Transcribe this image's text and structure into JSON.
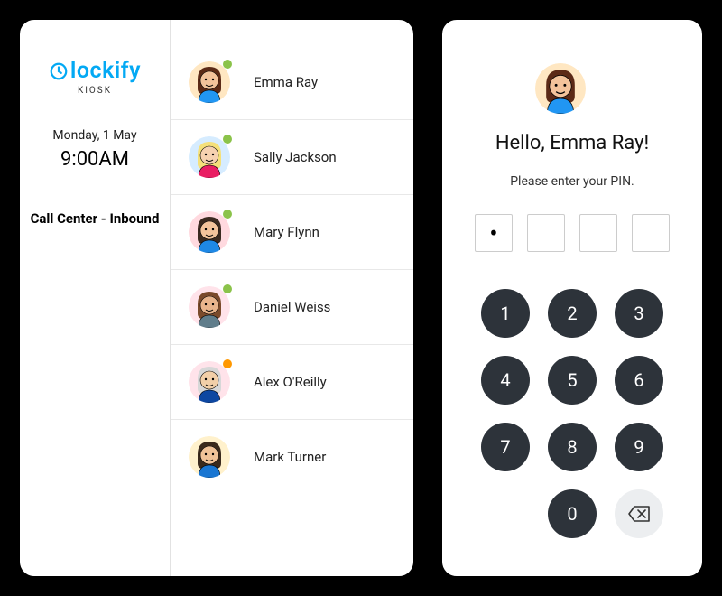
{
  "brand": {
    "name": "lockify",
    "sub": "KIOSK",
    "color": "#03a9f4"
  },
  "sidebar": {
    "date": "Monday, 1 May",
    "time": "9:00AM",
    "department": "Call Center - Inbound"
  },
  "status_colors": {
    "green": "#8bc34a",
    "orange": "#ff9800"
  },
  "members": [
    {
      "name": "Emma Ray",
      "status": "green",
      "bg": "#ffe7c2",
      "hair": "#5c2a16",
      "skin": "#f3c39b",
      "shirt": "#2196f3"
    },
    {
      "name": "Sally Jackson",
      "status": "green",
      "bg": "#d6ecff",
      "hair": "#f5e07a",
      "skin": "#f6d1b0",
      "shirt": "#e91e63"
    },
    {
      "name": "Mary Flynn",
      "status": "green",
      "bg": "#ffd9df",
      "hair": "#3b2a20",
      "skin": "#f3c39b",
      "shirt": "#1e88e5"
    },
    {
      "name": "Daniel Weiss",
      "status": "green",
      "bg": "#ffe3ea",
      "hair": "#7a4a2b",
      "skin": "#e8b48c",
      "shirt": "#607d8b"
    },
    {
      "name": "Alex O'Reilly",
      "status": "orange",
      "bg": "#ffe3ea",
      "hair": "#d7d7d7",
      "skin": "#f2cfa8",
      "shirt": "#0d47a1"
    },
    {
      "name": "Mark Turner",
      "status": "none",
      "bg": "#fff1cc",
      "hair": "#3a2a1c",
      "skin": "#f0c398",
      "shirt": "#1976d2"
    }
  ],
  "pin": {
    "selected_member": "Emma Ray",
    "greeting": "Hello, Emma Ray!",
    "instruction": "Please enter your PIN.",
    "digits_entered": 1,
    "digits_total": 4,
    "keypad": [
      "1",
      "2",
      "3",
      "4",
      "5",
      "6",
      "7",
      "8",
      "9",
      "",
      "0",
      "del"
    ],
    "avatar": {
      "bg": "#ffe7c2",
      "hair": "#5c2a16",
      "skin": "#f3c39b",
      "shirt": "#2196f3"
    }
  }
}
